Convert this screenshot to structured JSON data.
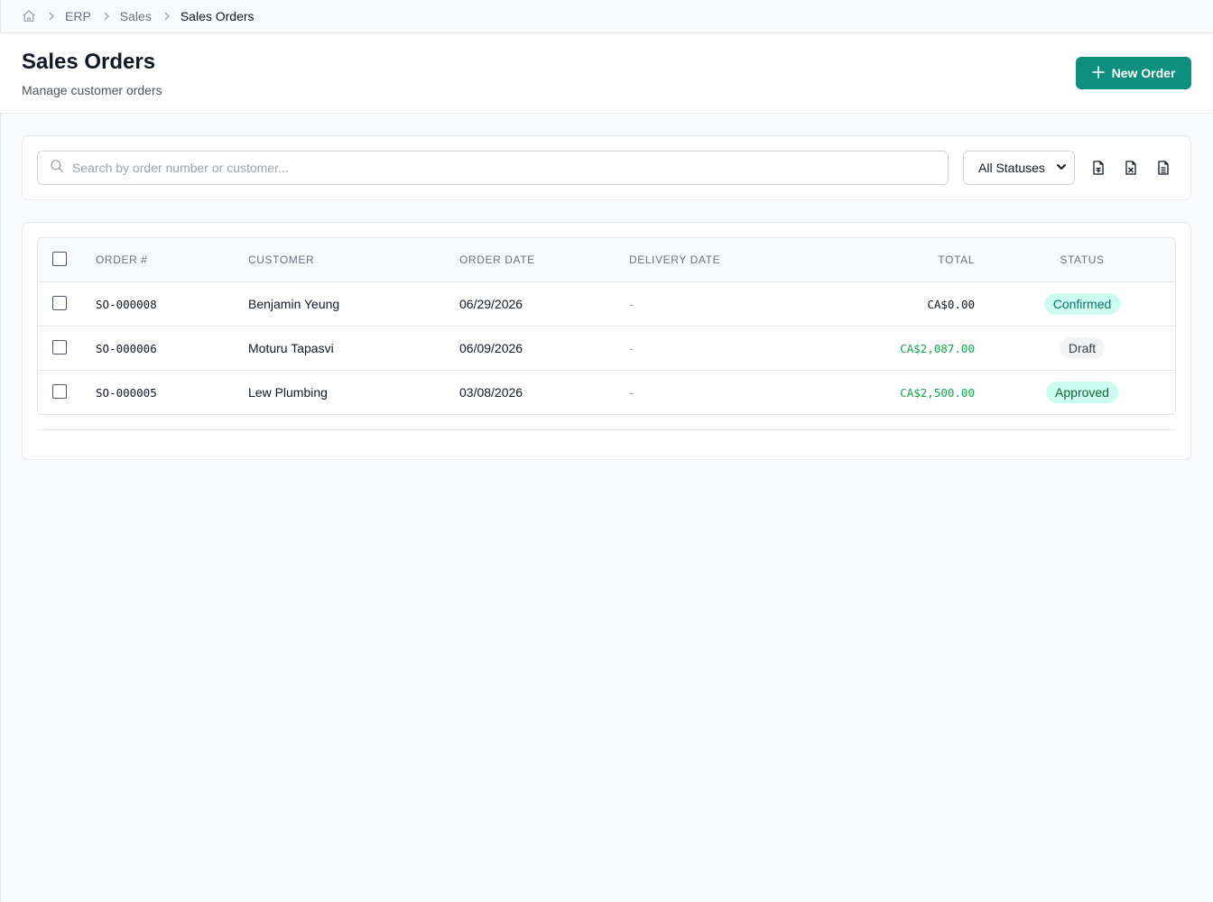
{
  "breadcrumb": {
    "items": [
      {
        "label": "ERP"
      },
      {
        "label": "Sales"
      },
      {
        "label": "Sales Orders"
      }
    ]
  },
  "header": {
    "title": "Sales Orders",
    "subtitle": "Manage customer orders",
    "new_button_label": "New Order"
  },
  "filters": {
    "search_placeholder": "Search by order number or customer...",
    "search_value": "",
    "status_selected": "All Statuses"
  },
  "table": {
    "columns": [
      "ORDER #",
      "CUSTOMER",
      "ORDER DATE",
      "DELIVERY DATE",
      "TOTAL",
      "STATUS"
    ],
    "rows": [
      {
        "order": "SO-000008",
        "customer": "Benjamin Yeung",
        "order_date": "06/29/2026",
        "delivery_date": "-",
        "total": "CA$0.00",
        "status": "Confirmed",
        "total_color": "#111827",
        "status_kind": "confirmed"
      },
      {
        "order": "SO-000006",
        "customer": "Moturu Tapasvi",
        "order_date": "06/09/2026",
        "delivery_date": "-",
        "total": "CA$2,087.00",
        "status": "Draft",
        "total_color": "#16a34a",
        "status_kind": "draft"
      },
      {
        "order": "SO-000005",
        "customer": "Lew Plumbing",
        "order_date": "03/08/2026",
        "delivery_date": "-",
        "total": "CA$2,500.00",
        "status": "Approved",
        "total_color": "#16a34a",
        "status_kind": "approved"
      }
    ]
  },
  "colors": {
    "accent": "#0f8f7e",
    "positive_amount": "#16a34a"
  },
  "icons": {
    "home": "home-icon",
    "chevron": "chevron-right-icon",
    "plus": "plus-icon",
    "search": "search-icon",
    "export": [
      "file-csv-icon",
      "file-excel-icon",
      "file-pdf-icon"
    ]
  }
}
